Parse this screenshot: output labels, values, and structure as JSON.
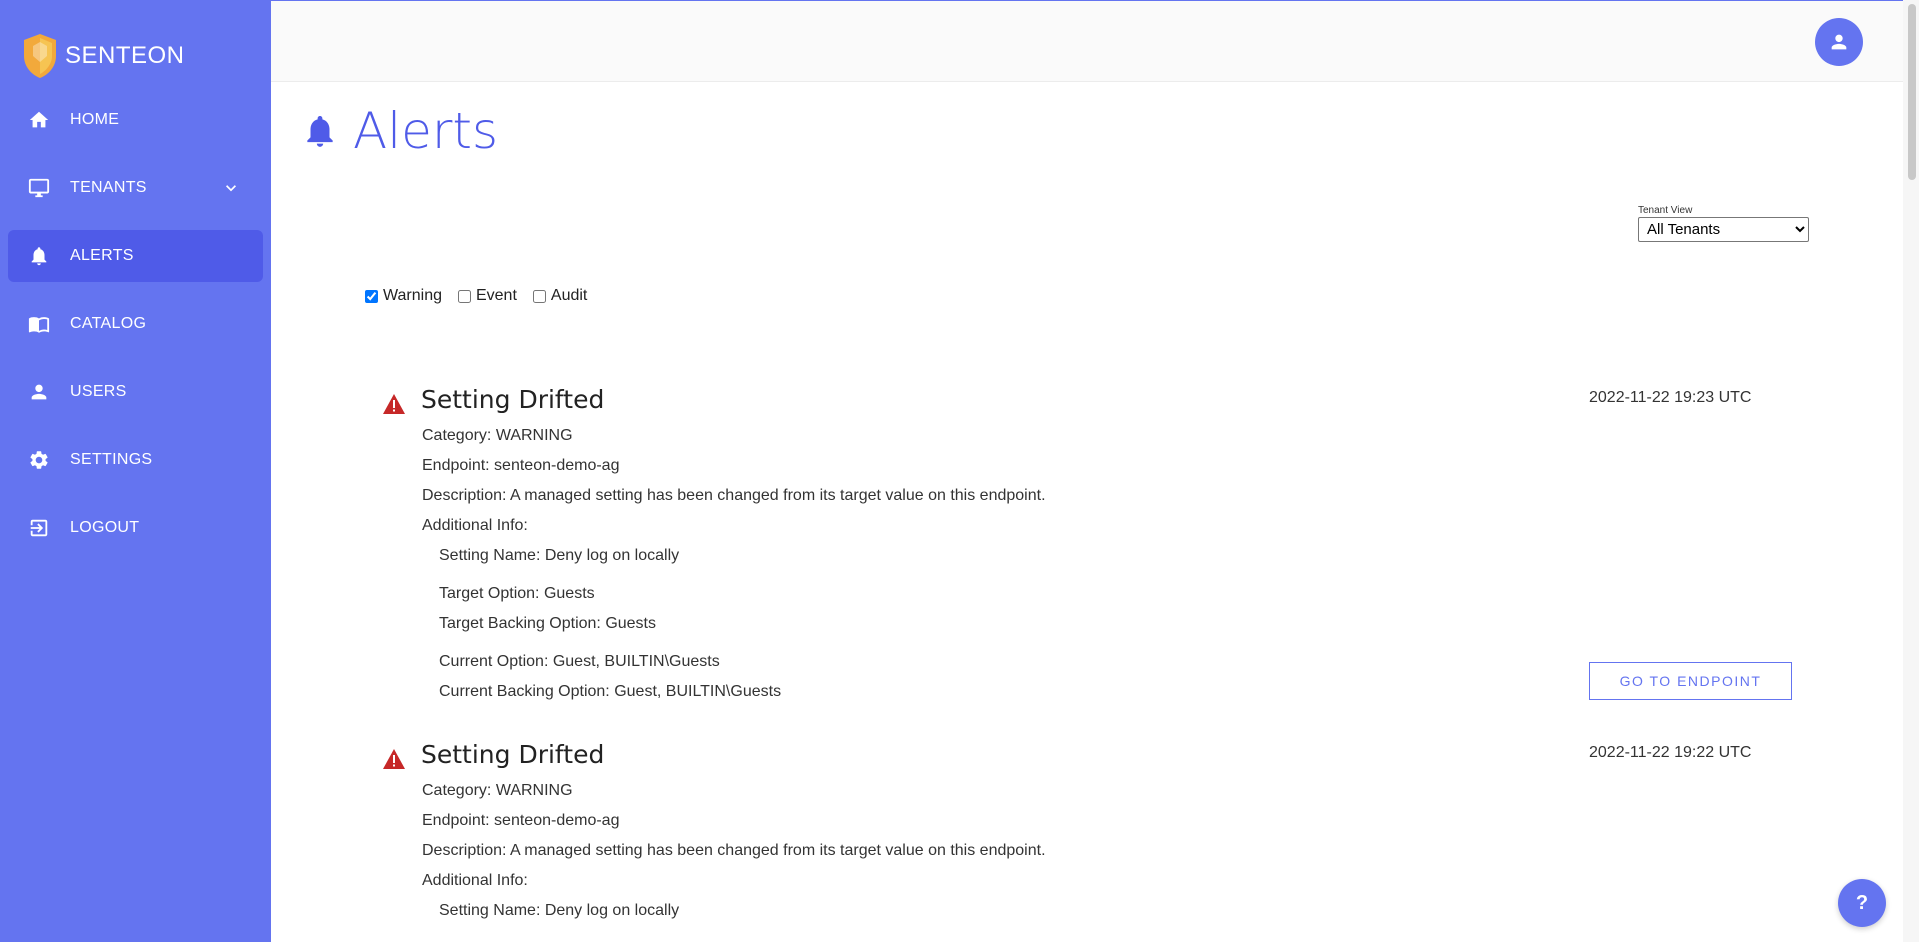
{
  "brand": {
    "name": "SENTEON"
  },
  "sidebar": {
    "items": [
      {
        "label": "HOME",
        "icon": "home-icon"
      },
      {
        "label": "TENANTS",
        "icon": "monitor-icon",
        "expandable": true
      },
      {
        "label": "ALERTS",
        "icon": "bell-icon",
        "active": true
      },
      {
        "label": "CATALOG",
        "icon": "book-icon"
      },
      {
        "label": "USERS",
        "icon": "user-icon"
      },
      {
        "label": "SETTINGS",
        "icon": "gear-icon"
      },
      {
        "label": "LOGOUT",
        "icon": "logout-icon"
      }
    ]
  },
  "page": {
    "title": "Alerts"
  },
  "tenant_view": {
    "label": "Tenant View",
    "selected": "All Tenants"
  },
  "filters": {
    "warning": {
      "label": "Warning",
      "checked": true
    },
    "event": {
      "label": "Event",
      "checked": false
    },
    "audit": {
      "label": "Audit",
      "checked": false
    }
  },
  "alerts": [
    {
      "title": "Setting Drifted",
      "time": "2022-11-22 19:23 UTC",
      "category": "Category: WARNING",
      "endpoint": "Endpoint: senteon-demo-ag",
      "description": "Description: A managed setting has been changed from its target value on this endpoint.",
      "additional": "Additional Info:",
      "setting_name": "Setting Name: Deny log on locally",
      "target_option": "Target Option: Guests",
      "target_backing": "Target Backing Option: Guests",
      "current_option": "Current Option: Guest, BUILTIN\\Guests",
      "current_backing": "Current Backing Option: Guest, BUILTIN\\Guests",
      "button": "GO TO ENDPOINT"
    },
    {
      "title": "Setting Drifted",
      "time": "2022-11-22 19:22 UTC",
      "category": "Category: WARNING",
      "endpoint": "Endpoint: senteon-demo-ag",
      "description": "Description: A managed setting has been changed from its target value on this endpoint.",
      "additional": "Additional Info:",
      "setting_name": "Setting Name: Deny log on locally"
    }
  ],
  "help": {
    "label": "?"
  },
  "colors": {
    "sidebar": "#6474f0",
    "active": "#4f5be8",
    "warning": "#c62828"
  }
}
